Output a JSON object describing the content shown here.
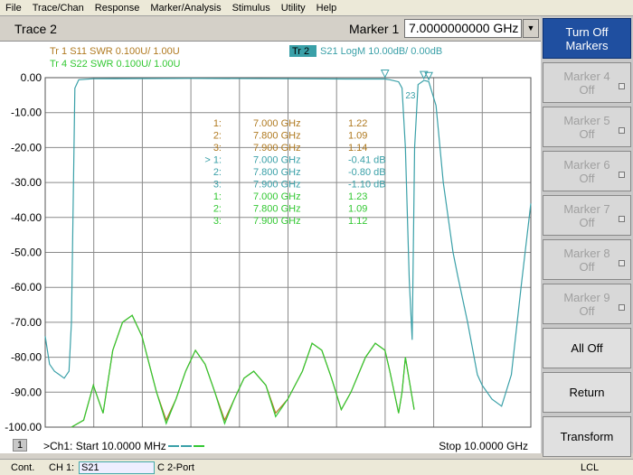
{
  "menu": [
    "File",
    "Trace/Chan",
    "Response",
    "Marker/Analysis",
    "Stimulus",
    "Utility",
    "Help"
  ],
  "header": {
    "trace_title": "Trace 2",
    "marker_label": "Marker 1",
    "marker_value": "7.0000000000 GHz"
  },
  "softkeys": [
    {
      "line1": "Turn Off",
      "line2": "Markers",
      "state": "active"
    },
    {
      "line1": "Marker 4",
      "line2": "Off",
      "state": "disabled"
    },
    {
      "line1": "Marker 5",
      "line2": "Off",
      "state": "disabled"
    },
    {
      "line1": "Marker 6",
      "line2": "Off",
      "state": "disabled"
    },
    {
      "line1": "Marker 7",
      "line2": "Off",
      "state": "disabled"
    },
    {
      "line1": "Marker 8",
      "line2": "Off",
      "state": "disabled"
    },
    {
      "line1": "Marker 9",
      "line2": "Off",
      "state": "disabled"
    },
    {
      "line1": "All Off",
      "line2": "",
      "state": "enabled"
    },
    {
      "line1": "Return",
      "line2": "",
      "state": "enabled"
    },
    {
      "line1": "Transform",
      "line2": "",
      "state": "enabled"
    }
  ],
  "legend": {
    "tr1": "Tr  1   S11  SWR  0.100U/   1.00U",
    "tr4": "Tr  4   S22  SWR  0.100U/   1.00U",
    "tr2_tag": "Tr  2",
    "tr2": "S21  LogM  10.00dB/   0.00dB"
  },
  "colors": {
    "tr1": "#b07a20",
    "tr2": "#3aa0a8",
    "tr4": "#33c833",
    "grid": "#8a8a8a"
  },
  "markers_table": [
    {
      "num": "1:",
      "freq": "7.000 GHz",
      "val": "1.22",
      "trace": "tr1"
    },
    {
      "num": "2:",
      "freq": "7.800 GHz",
      "val": "1.09",
      "trace": "tr1"
    },
    {
      "num": "3:",
      "freq": "7.900 GHz",
      "val": "1.14",
      "trace": "tr1"
    },
    {
      "num": "> 1:",
      "freq": "7.000 GHz",
      "val": "-0.41 dB",
      "trace": "tr2"
    },
    {
      "num": "2:",
      "freq": "7.800 GHz",
      "val": "-0.80 dB",
      "trace": "tr2"
    },
    {
      "num": "3:",
      "freq": "7.900 GHz",
      "val": "-1.10 dB",
      "trace": "tr2"
    },
    {
      "num": "1:",
      "freq": "7.000 GHz",
      "val": "1.23",
      "trace": "tr4"
    },
    {
      "num": "2:",
      "freq": "7.800 GHz",
      "val": "1.09",
      "trace": "tr4"
    },
    {
      "num": "3:",
      "freq": "7.900 GHz",
      "val": "1.12",
      "trace": "tr4"
    }
  ],
  "bottom": {
    "channel_num": "1",
    "start": ">Ch1: Start  10.0000 MHz",
    "stop": "Stop  10.0000 GHz"
  },
  "status": {
    "cont": "Cont.",
    "ch": "CH 1:",
    "param": "S21",
    "port": "C  2-Port",
    "lcl": "LCL"
  },
  "marker_flag_label": "23",
  "chart_data": {
    "type": "line",
    "ylabel_ticks": [
      "0.00",
      "-10.00",
      "-20.00",
      "-30.00",
      "-40.00",
      "-50.00",
      "-60.00",
      "-70.00",
      "-80.00",
      "-90.00",
      "-100.00"
    ],
    "y_range": [
      -100,
      0
    ],
    "x_range_ghz": [
      0.01,
      10.0
    ],
    "grid": true,
    "series": [
      {
        "name": "S21",
        "points": [
          [
            0.01,
            -74
          ],
          [
            0.1,
            -82
          ],
          [
            0.2,
            -84
          ],
          [
            0.3,
            -85
          ],
          [
            0.4,
            -86
          ],
          [
            0.5,
            -84
          ],
          [
            0.55,
            -70
          ],
          [
            0.62,
            -3
          ],
          [
            0.7,
            -0.6
          ],
          [
            1.0,
            -0.3
          ],
          [
            3.0,
            -0.2
          ],
          [
            5.0,
            -0.3
          ],
          [
            6.3,
            -0.4
          ],
          [
            7.0,
            -0.4
          ],
          [
            7.1,
            -0.6
          ],
          [
            7.28,
            -1.2
          ],
          [
            7.35,
            -3
          ],
          [
            7.42,
            -20
          ],
          [
            7.5,
            -58
          ],
          [
            7.56,
            -75
          ],
          [
            7.61,
            -20
          ],
          [
            7.68,
            -2
          ],
          [
            7.8,
            -0.8
          ],
          [
            7.9,
            -1.1
          ],
          [
            8.05,
            -8
          ],
          [
            8.2,
            -30
          ],
          [
            8.4,
            -50
          ],
          [
            8.5,
            -57
          ],
          [
            8.7,
            -70
          ],
          [
            8.9,
            -85
          ],
          [
            9.0,
            -88
          ],
          [
            9.2,
            -92
          ],
          [
            9.4,
            -94
          ],
          [
            9.6,
            -85
          ],
          [
            9.8,
            -60
          ],
          [
            10.0,
            -36
          ]
        ]
      },
      {
        "name": "S11",
        "points": [
          [
            0.55,
            -100
          ],
          [
            0.8,
            -98
          ],
          [
            1.0,
            -88
          ],
          [
            1.2,
            -96
          ],
          [
            1.4,
            -78
          ],
          [
            1.6,
            -70
          ],
          [
            1.8,
            -68
          ],
          [
            2.0,
            -74
          ],
          [
            2.3,
            -90
          ],
          [
            2.5,
            -98
          ],
          [
            2.7,
            -92
          ],
          [
            2.9,
            -84
          ],
          [
            3.1,
            -78
          ],
          [
            3.3,
            -82
          ],
          [
            3.5,
            -90
          ],
          [
            3.7,
            -98
          ],
          [
            3.9,
            -92
          ],
          [
            4.1,
            -86
          ],
          [
            4.3,
            -84
          ],
          [
            4.55,
            -88
          ],
          [
            4.75,
            -96
          ],
          [
            5.0,
            -92
          ],
          [
            5.3,
            -84
          ],
          [
            5.5,
            -76
          ],
          [
            5.7,
            -78
          ],
          [
            5.9,
            -86
          ],
          [
            6.1,
            -95
          ],
          [
            6.3,
            -90
          ],
          [
            6.6,
            -80
          ],
          [
            6.8,
            -76
          ],
          [
            7.0,
            -78
          ],
          [
            7.1,
            -84
          ],
          [
            7.28,
            -96
          ],
          [
            7.35,
            -90
          ],
          [
            7.42,
            -80
          ],
          [
            7.6,
            -95
          ]
        ]
      },
      {
        "name": "S22",
        "points": [
          [
            0.55,
            -100
          ],
          [
            0.8,
            -98
          ],
          [
            1.0,
            -88
          ],
          [
            1.2,
            -96
          ],
          [
            1.4,
            -78
          ],
          [
            1.6,
            -70
          ],
          [
            1.8,
            -68
          ],
          [
            2.0,
            -74
          ],
          [
            2.3,
            -90
          ],
          [
            2.5,
            -99
          ],
          [
            2.7,
            -92
          ],
          [
            2.9,
            -84
          ],
          [
            3.1,
            -78
          ],
          [
            3.3,
            -82
          ],
          [
            3.5,
            -90
          ],
          [
            3.7,
            -99
          ],
          [
            3.9,
            -92
          ],
          [
            4.1,
            -86
          ],
          [
            4.3,
            -84
          ],
          [
            4.55,
            -88
          ],
          [
            4.75,
            -97
          ],
          [
            5.0,
            -92
          ],
          [
            5.3,
            -84
          ],
          [
            5.5,
            -76
          ],
          [
            5.7,
            -78
          ],
          [
            5.9,
            -86
          ],
          [
            6.1,
            -95
          ],
          [
            6.3,
            -90
          ],
          [
            6.6,
            -80
          ],
          [
            6.8,
            -76
          ],
          [
            7.0,
            -78
          ],
          [
            7.1,
            -84
          ],
          [
            7.28,
            -96
          ],
          [
            7.35,
            -90
          ],
          [
            7.42,
            -80
          ],
          [
            7.6,
            -95
          ]
        ]
      }
    ]
  }
}
